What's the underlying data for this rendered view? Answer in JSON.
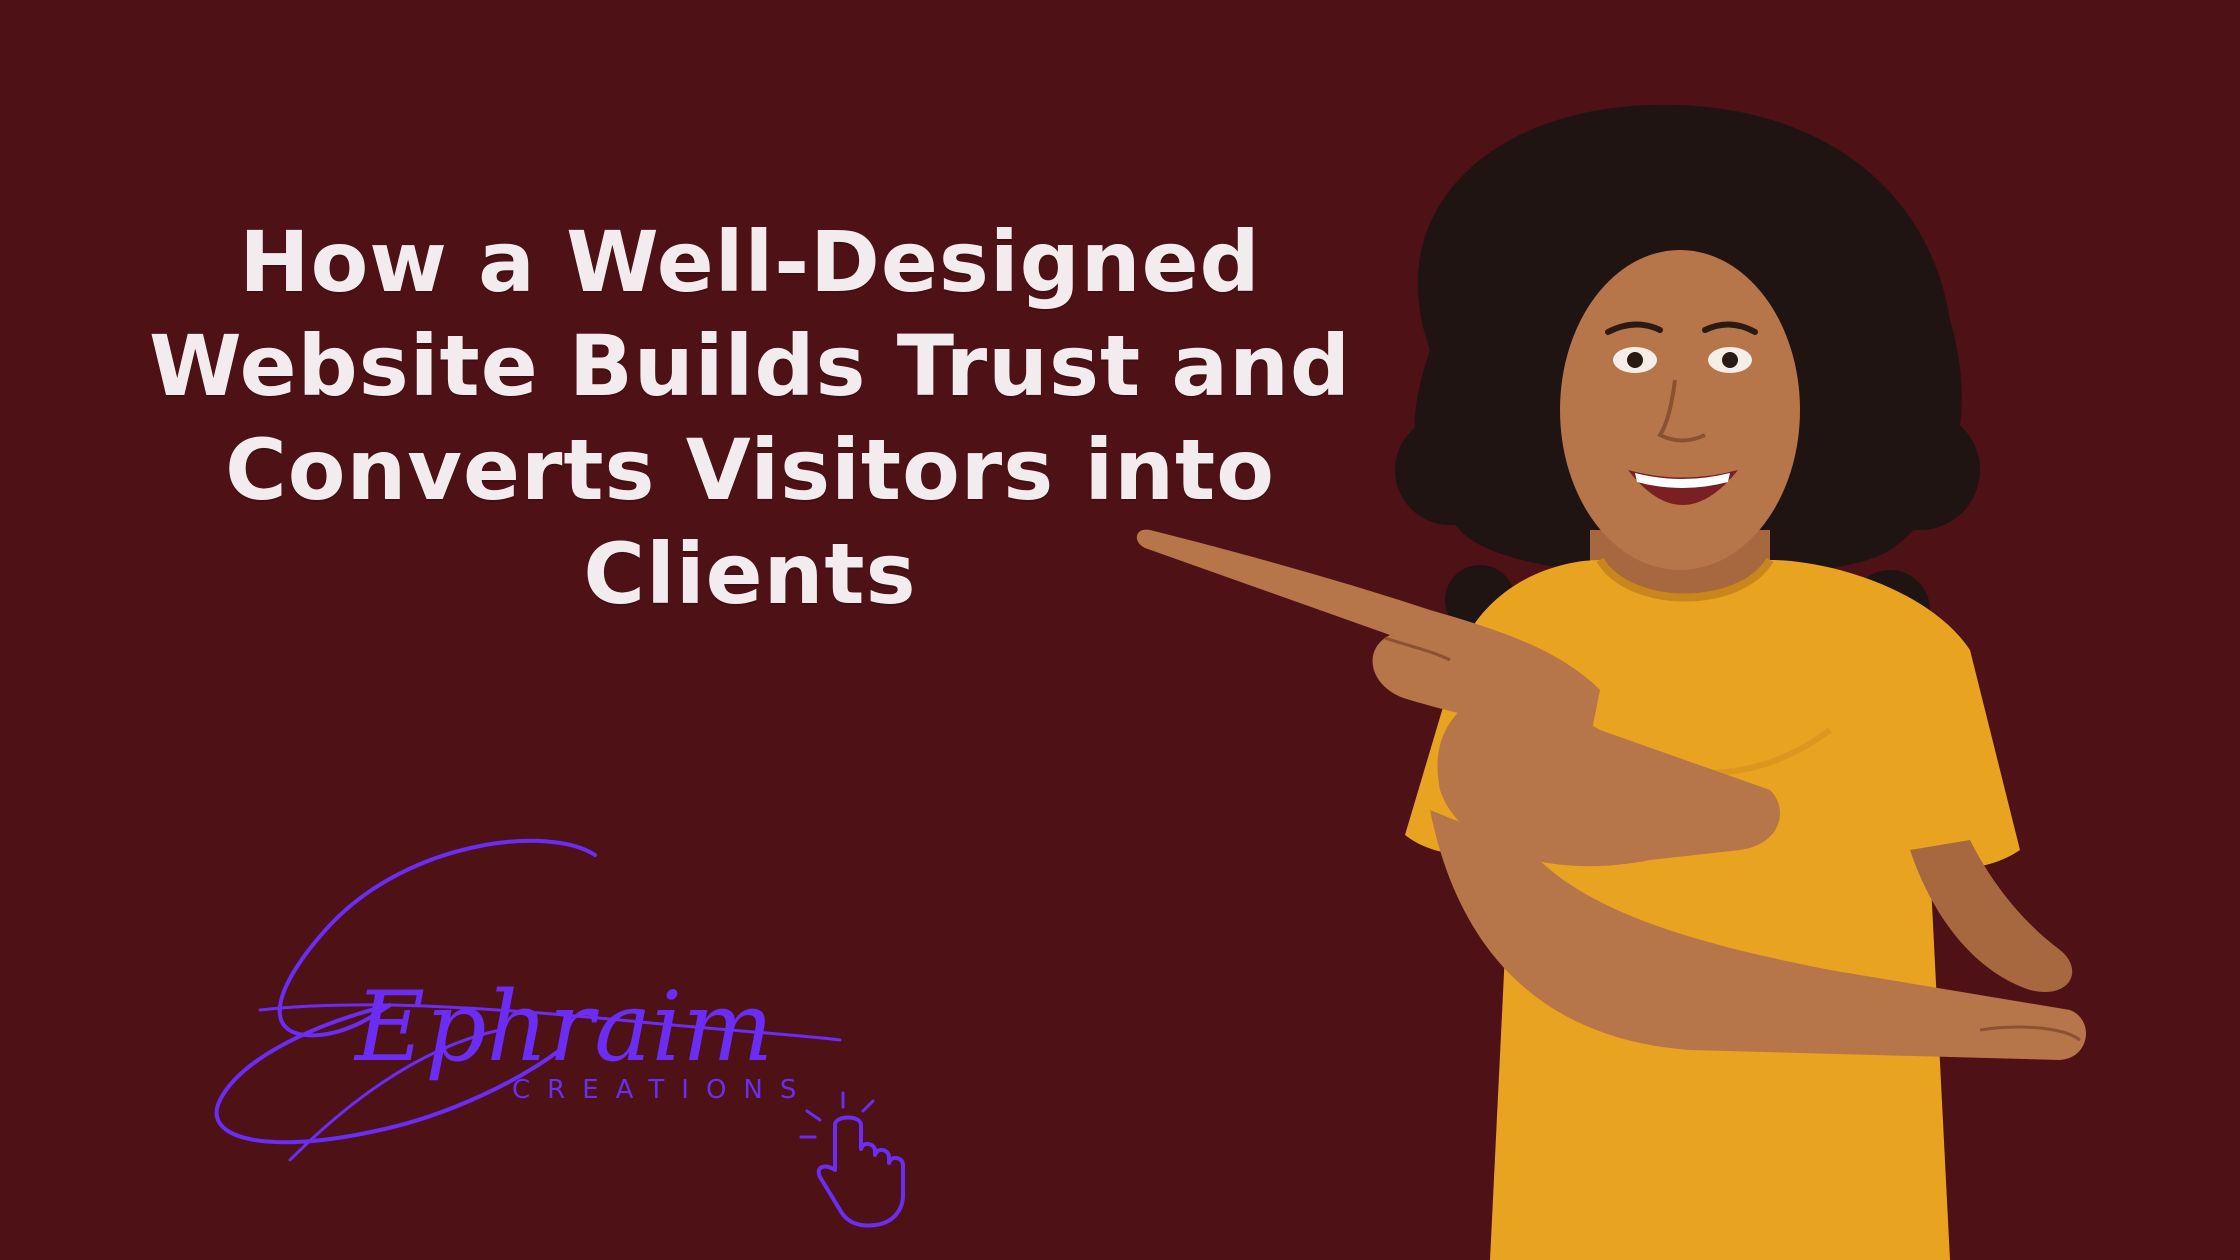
{
  "headline": {
    "lines": [
      "How a Well-Designed",
      "Website Builds Trust and",
      "Converts Visitors into",
      "Clients"
    ]
  },
  "logo": {
    "wordmark": "Ephraim",
    "subtitle": "CREATIONS",
    "icon": "pointing-hand-click-icon"
  },
  "colors": {
    "background": "#4e1115",
    "headline": "#f2ecee",
    "logo": "#6b2cf3",
    "shirt": "#e8a321",
    "skin": "#b7754a",
    "hair": "#1f1411"
  }
}
